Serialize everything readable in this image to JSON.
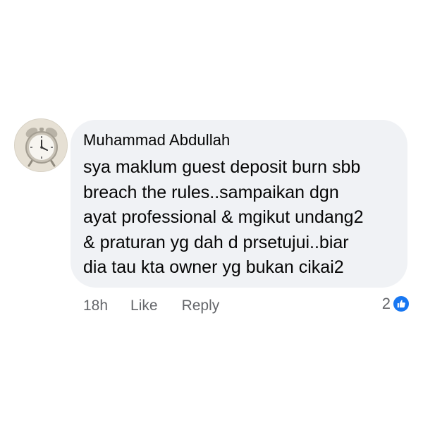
{
  "comment": {
    "author": "Muhammad Abdullah",
    "text": "sya maklum guest deposit burn sbb\nbreach the rules..sampaikan dgn\nayat professional & mgikut undang2\n& praturan yg dah d prsetujui..biar\ndia tau kta owner yg bukan cikai2",
    "avatar_icon": "alarm-clock-icon"
  },
  "actions": {
    "time": "18h",
    "like_label": "Like",
    "reply_label": "Reply"
  },
  "reactions": {
    "count": "2",
    "icon": "thumbs-up-icon",
    "color": "#1877f2"
  },
  "colors": {
    "bubble": "#f0f2f5",
    "text": "#050505",
    "muted": "#65676b"
  }
}
